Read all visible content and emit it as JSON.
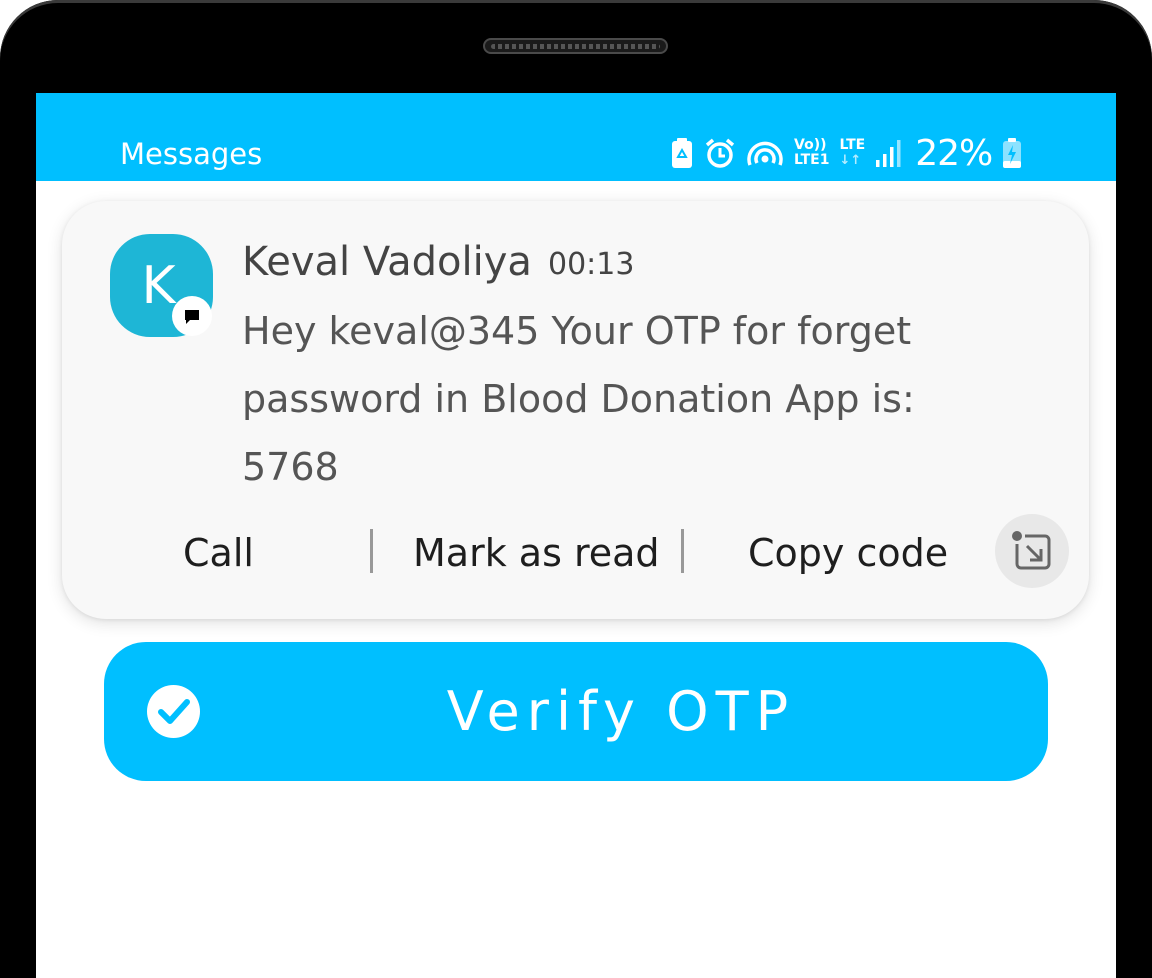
{
  "status_bar": {
    "app_name": "Messages",
    "network_volte": "Vo))",
    "network_lte1": "LTE1",
    "network_lte": "LTE",
    "battery_percent": "22%",
    "icons": [
      "battery-saver-icon",
      "alarm-icon",
      "hotspot-icon",
      "volte-icon",
      "lte-data-icon",
      "signal-icon",
      "battery-charging-icon"
    ],
    "color": "#00bfff"
  },
  "notification": {
    "avatar_letter": "K",
    "avatar_color": "#1eb6d6",
    "sender": "Keval Vadoliya",
    "time": "00:13",
    "message": "Hey keval@345 Your OTP for forget password in Blood Donation App is: 5768",
    "actions": {
      "call": "Call",
      "mark_read": "Mark as read",
      "copy_code": "Copy code"
    }
  },
  "verify_button": {
    "label": "Verify OTP",
    "color": "#00bfff"
  }
}
